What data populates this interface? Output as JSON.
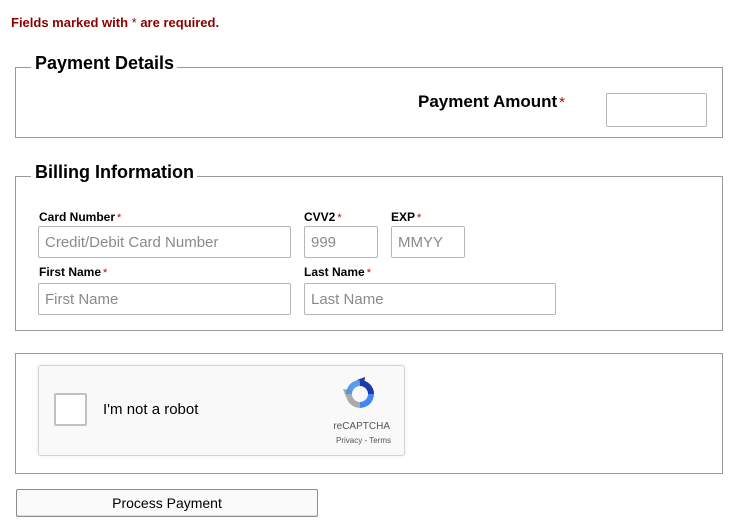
{
  "notice": {
    "prefix": "Fields marked with ",
    "star": "*",
    "suffix": " are required."
  },
  "payment_details": {
    "legend": "Payment Details",
    "amount_label": "Payment Amount",
    "amount_star": "*",
    "amount_value": ""
  },
  "billing": {
    "legend": "Billing Information",
    "card_number": {
      "label": "Card Number",
      "star": "*",
      "placeholder": "Credit/Debit Card Number",
      "value": ""
    },
    "cvv2": {
      "label": "CVV2",
      "star": "*",
      "placeholder": "999",
      "value": ""
    },
    "exp": {
      "label": "EXP",
      "star": "*",
      "placeholder": "MMYY",
      "value": ""
    },
    "first_name": {
      "label": "First Name",
      "star": "*",
      "placeholder": "First Name",
      "value": ""
    },
    "last_name": {
      "label": "Last Name",
      "star": "*",
      "placeholder": "Last Name",
      "value": ""
    }
  },
  "captcha": {
    "checkbox_label": "I'm not a robot",
    "brand": "reCAPTCHA",
    "privacy_link": "Privacy",
    "separator": " - ",
    "terms_link": "Terms",
    "checked": false,
    "icon": "recaptcha-icon"
  },
  "actions": {
    "process_label": "Process Payment"
  },
  "colors": {
    "required_note": "#8b0000",
    "required_star": "#c00000",
    "border": "#9a9a9a"
  }
}
